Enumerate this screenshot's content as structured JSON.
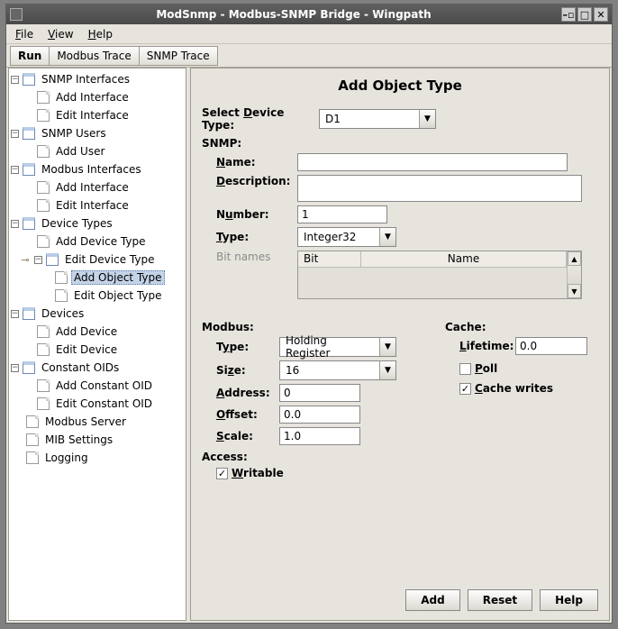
{
  "window": {
    "title": "ModSnmp - Modbus-SNMP Bridge - Wingpath"
  },
  "menu": {
    "file": "File",
    "view": "View",
    "help": "Help"
  },
  "tabs": {
    "run": "Run",
    "modbus_trace": "Modbus Trace",
    "snmp_trace": "SNMP Trace"
  },
  "tree": {
    "snmp_if": "SNMP Interfaces",
    "snmp_if_add": "Add Interface",
    "snmp_if_edit": "Edit Interface",
    "snmp_users": "SNMP Users",
    "snmp_users_add": "Add User",
    "modbus_if": "Modbus Interfaces",
    "modbus_if_add": "Add Interface",
    "modbus_if_edit": "Edit Interface",
    "dev_types": "Device Types",
    "dev_types_add": "Add Device Type",
    "dev_types_edit": "Edit Device Type",
    "obj_add": "Add Object Type",
    "obj_edit": "Edit Object Type",
    "devices": "Devices",
    "devices_add": "Add Device",
    "devices_edit": "Edit Device",
    "const_oids": "Constant OIDs",
    "const_oids_add": "Add Constant OID",
    "const_oids_edit": "Edit Constant OID",
    "modbus_server": "Modbus Server",
    "mib_settings": "MIB Settings",
    "logging": "Logging"
  },
  "panel": {
    "title": "Add Object Type",
    "select_device_label": "Select Device Type:",
    "device_value": "D1",
    "snmp_label": "SNMP:",
    "name_label": "Name:",
    "name_value": "",
    "desc_label": "Description:",
    "desc_value": "",
    "number_label": "Number:",
    "number_value": "1",
    "type_label": "Type:",
    "type_value": "Integer32",
    "bitnames_label": "Bit names",
    "bit_hdr_bit": "Bit",
    "bit_hdr_name": "Name",
    "modbus_label": "Modbus:",
    "m_type_label": "Type:",
    "m_type_value": "Holding Register",
    "m_size_label": "Size:",
    "m_size_value": "16",
    "m_address_label": "Address:",
    "m_address_value": "0",
    "m_offset_label": "Offset:",
    "m_offset_value": "0.0",
    "m_scale_label": "Scale:",
    "m_scale_value": "1.0",
    "access_label": "Access:",
    "writable_label": "Writable",
    "cache_label": "Cache:",
    "lifetime_label": "Lifetime:",
    "lifetime_value": "0.0",
    "poll_label": "Poll",
    "cache_writes_label": "Cache writes"
  },
  "buttons": {
    "add": "Add",
    "reset": "Reset",
    "help": "Help"
  }
}
